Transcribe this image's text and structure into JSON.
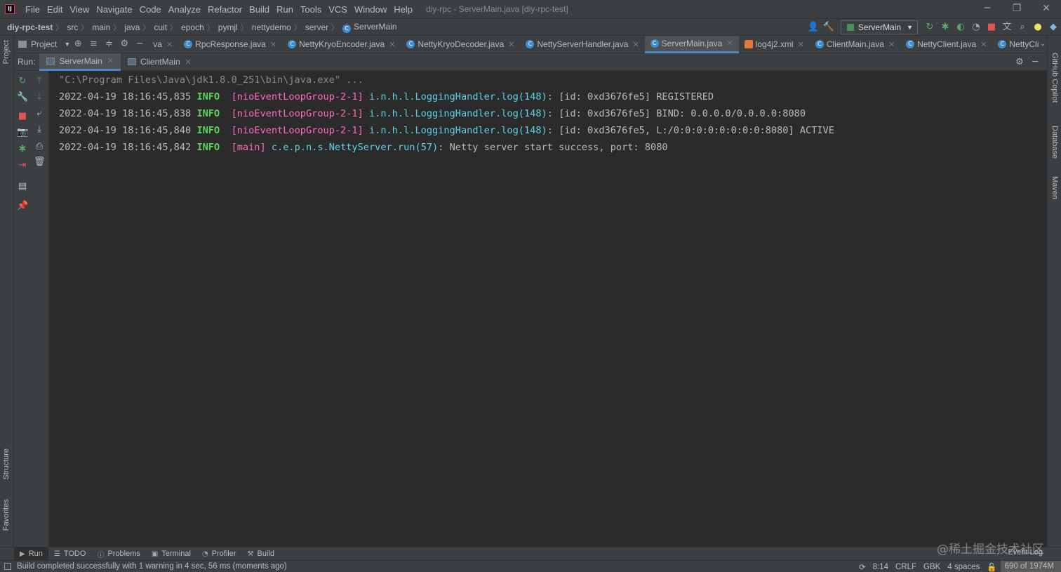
{
  "menubar": {
    "items": [
      "File",
      "Edit",
      "View",
      "Navigate",
      "Code",
      "Analyze",
      "Refactor",
      "Build",
      "Run",
      "Tools",
      "VCS",
      "Window",
      "Help"
    ],
    "title": "diy-rpc - ServerMain.java [diy-rpc-test]"
  },
  "breadcrumbs": [
    "diy-rpc-test",
    "src",
    "main",
    "java",
    "cuit",
    "epoch",
    "pymjl",
    "nettydemo",
    "server",
    "ServerMain"
  ],
  "run_config": "ServerMain",
  "project_panel": {
    "label": "Project"
  },
  "editor_tabs": [
    {
      "label": "va",
      "active": false
    },
    {
      "label": "RpcResponse.java",
      "active": false
    },
    {
      "label": "NettyKryoEncoder.java",
      "active": false
    },
    {
      "label": "NettyKryoDecoder.java",
      "active": false
    },
    {
      "label": "NettyServerHandler.java",
      "active": false
    },
    {
      "label": "ServerMain.java",
      "active": true
    },
    {
      "label": "log4j2.xml",
      "active": false
    },
    {
      "label": "ClientMain.java",
      "active": false
    },
    {
      "label": "NettyClient.java",
      "active": false
    },
    {
      "label": "NettyCli",
      "active": false
    }
  ],
  "run_panel": {
    "label": "Run:",
    "tabs": [
      {
        "label": "ServerMain",
        "active": true
      },
      {
        "label": "ClientMain",
        "active": false
      }
    ]
  },
  "console": {
    "command": "\"C:\\Program Files\\Java\\jdk1.8.0_251\\bin\\java.exe\" ...",
    "lines": [
      {
        "time": "2022-04-19 18:16:45,835",
        "level": "INFO",
        "thread": "[nioEventLoopGroup-2-1]",
        "logger": "i.n.h.l.LoggingHandler.log(148)",
        "msg": ": [id: 0xd3676fe5] REGISTERED"
      },
      {
        "time": "2022-04-19 18:16:45,838",
        "level": "INFO",
        "thread": "[nioEventLoopGroup-2-1]",
        "logger": "i.n.h.l.LoggingHandler.log(148)",
        "msg": ": [id: 0xd3676fe5] BIND: 0.0.0.0/0.0.0.0:8080"
      },
      {
        "time": "2022-04-19 18:16:45,840",
        "level": "INFO",
        "thread": "[nioEventLoopGroup-2-1]",
        "logger": "i.n.h.l.LoggingHandler.log(148)",
        "msg": ": [id: 0xd3676fe5, L:/0:0:0:0:0:0:0:0:8080] ACTIVE"
      },
      {
        "time": "2022-04-19 18:16:45,842",
        "level": "INFO",
        "thread": "[main]",
        "logger": "c.e.p.n.s.NettyServer.run(57)",
        "msg": ": Netty server start success, port: 8080"
      }
    ]
  },
  "left_strip": {
    "project": "Project",
    "structure": "Structure",
    "favorites": "Favorites"
  },
  "right_strip": {
    "copilot": "GitHub Copilot",
    "database": "Database",
    "maven": "Maven"
  },
  "bottom_tools": [
    "Run",
    "TODO",
    "Problems",
    "Terminal",
    "Profiler",
    "Build"
  ],
  "event_log": "Event Log",
  "watermark": "@稀土掘金技术社区",
  "status": {
    "message": "Build completed successfully with 1 warning in 4 sec, 56 ms (moments ago)",
    "position": "8:14",
    "line_sep": "CRLF",
    "encoding": "GBK",
    "indent": "4 spaces",
    "memory": "690 of 1974M"
  }
}
